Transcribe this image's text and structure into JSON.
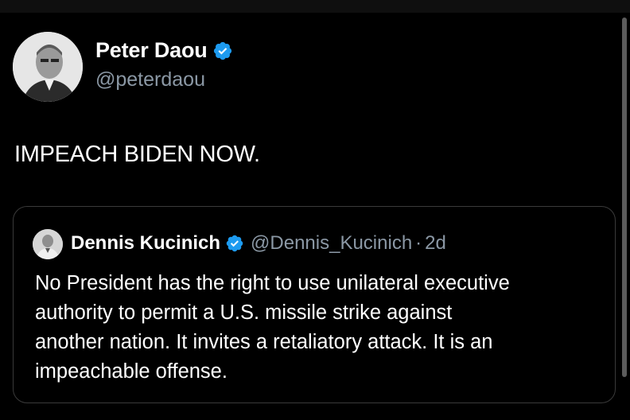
{
  "tweet": {
    "author": {
      "name": "Peter Daou",
      "handle": "@peterdaou",
      "avatar_icon": "profile-photo",
      "verified_icon": "verified-badge-icon"
    },
    "text": "IMPEACH BIDEN NOW."
  },
  "quote": {
    "author": {
      "name": "Dennis Kucinich",
      "handle": "@Dennis_Kucinich",
      "avatar_icon": "profile-photo",
      "verified_icon": "verified-badge-icon"
    },
    "separator": "·",
    "time": "2d",
    "text": "No President has the right to use unilateral executive\nauthority to permit a U.S. missile strike against\nanother nation. It invites a retaliatory attack.  It is an\nimpeachable offense."
  },
  "colors": {
    "background": "#000000",
    "text_primary": "#ffffff",
    "text_secondary": "#8b98a5",
    "verified_blue": "#1d9bf0",
    "card_border": "#3a3a3a"
  }
}
